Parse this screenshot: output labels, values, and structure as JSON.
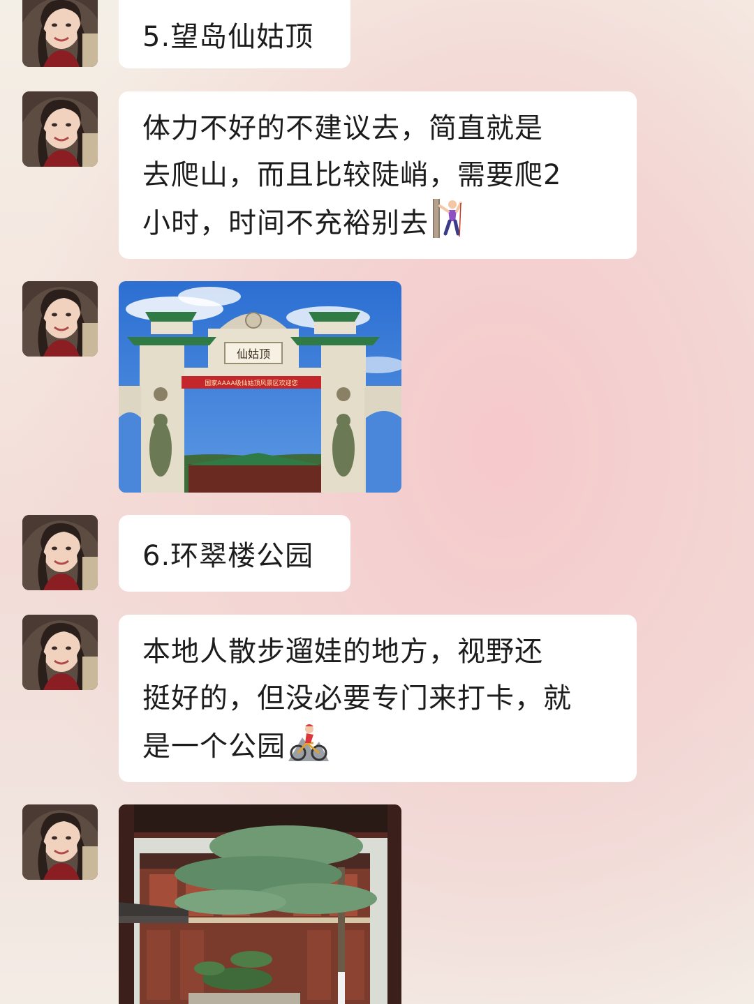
{
  "messages": [
    {
      "type": "text",
      "text": "5.望岛仙姑顶"
    },
    {
      "type": "text",
      "lines": [
        "体力不好的不建议去，简直就是",
        "去爬山，而且比较陡峭，需要爬2",
        "小时，时间不充裕别去"
      ],
      "emoji": "person-climbing-icon"
    },
    {
      "type": "image",
      "content": "gate-photo",
      "sign_main": "仙姑顶",
      "sign_banner": "国家AAAA级仙姑顶风景区欢迎您"
    },
    {
      "type": "text",
      "text": "6.环翠楼公园"
    },
    {
      "type": "text",
      "lines": [
        "本地人散步遛娃的地方，视野还",
        "挺好的，但没必要专门来打卡，就",
        "是一个公园"
      ],
      "emoji": "mountain-biker-icon"
    },
    {
      "type": "image",
      "content": "pavilion-photo"
    }
  ],
  "colors": {
    "bubble": "#ffffff",
    "text": "#1c1c1c",
    "sky": "#3f7fd6",
    "banner": "#c3262b"
  }
}
